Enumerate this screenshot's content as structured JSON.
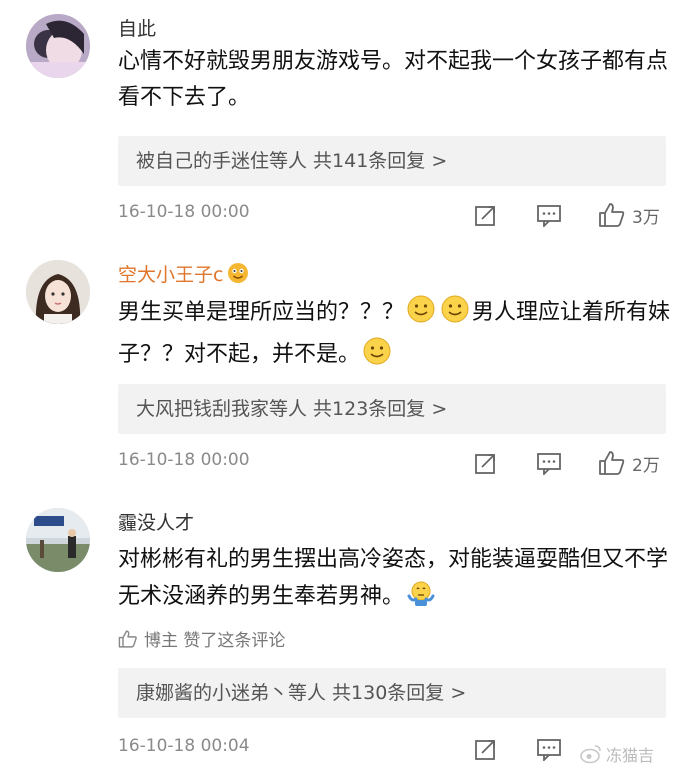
{
  "comments": [
    {
      "username": "自此",
      "text": "心情不好就毁男朋友游戏号。对不起我一个女孩子都有点看不下去了。",
      "replies": "被自己的手迷住等人  共141条回复 >",
      "time": "16-10-18 00:00",
      "likes": "3万",
      "icons": [
        "repost-icon",
        "comment-icon",
        "like-icon"
      ]
    },
    {
      "username": "空大小王子c",
      "badge_icon": "vip-face-icon",
      "text_parts": [
        "男生买单是理所应当的？？？",
        "男人理应让着所有妹子？？对不起，并不是。"
      ],
      "emoji_icon": "smile-emoji-icon",
      "replies": "大风把钱刮我家等人  共123条回复 >",
      "time": "16-10-18 00:00",
      "likes": "2万",
      "icons": [
        "repost-icon",
        "comment-icon",
        "like-icon"
      ]
    },
    {
      "username": "霾没人才",
      "text": "对彬彬有礼的男生摆出高冷姿态，对能装逼耍酷但又不学无术没涵养的男生奉若男神。",
      "emoji_icon": "shrug-emoji-icon",
      "liked_by": "博主 赞了这条评论",
      "replies": "康娜酱的小迷弟丶等人  共130条回复 >",
      "time": "16-10-18 00:04",
      "icons": [
        "repost-icon",
        "comment-icon"
      ]
    }
  ],
  "watermark": "冻猫吉"
}
